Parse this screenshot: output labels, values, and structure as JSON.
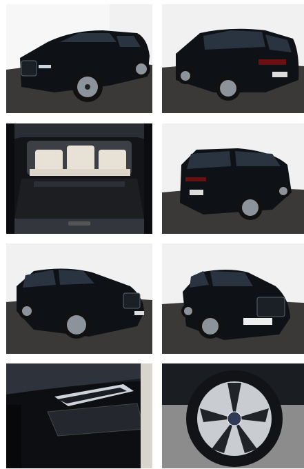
{
  "gallery": {
    "photos": [
      {
        "label": "front-three-quarter"
      },
      {
        "label": "rear-three-quarter"
      },
      {
        "label": "cargo-area"
      },
      {
        "label": "rear-side"
      },
      {
        "label": "front-left"
      },
      {
        "label": "front-right"
      },
      {
        "label": "headlight-detail"
      },
      {
        "label": "wheel-detail"
      }
    ],
    "plate_text": "",
    "colors": {
      "car_body": "#0e1116",
      "studio_wall": "#f2f2f2",
      "studio_floor": "#3a3837",
      "cream_seats": "#e8e2d6"
    }
  }
}
